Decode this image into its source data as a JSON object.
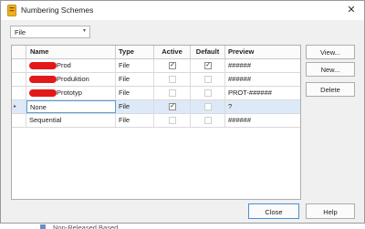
{
  "window": {
    "title": "Numbering Schemes",
    "close_glyph": "✕"
  },
  "filter": {
    "value": "File",
    "arrow_glyph": "▾"
  },
  "grid": {
    "columns": [
      "Name",
      "Type",
      "Active",
      "Default",
      "Preview"
    ],
    "rows": [
      {
        "name": "Prod",
        "type": "File",
        "active": true,
        "default": true,
        "preview": "######",
        "name_redacted": true,
        "selected": false
      },
      {
        "name": "Produktion",
        "type": "File",
        "active": false,
        "default": false,
        "preview": "######",
        "name_redacted": true,
        "selected": false
      },
      {
        "name": "Prototyp",
        "type": "File",
        "active": false,
        "default": false,
        "preview": "PROT-######",
        "name_redacted": true,
        "selected": false
      },
      {
        "name": "None",
        "type": "File",
        "active": true,
        "default": false,
        "preview": "?",
        "name_redacted": false,
        "selected": true
      },
      {
        "name": "Sequential",
        "type": "File",
        "active": false,
        "default": false,
        "preview": "######",
        "name_redacted": false,
        "selected": false
      }
    ],
    "current_row_glyph": "▸",
    "check_glyph": "✓"
  },
  "buttons": {
    "view": "View...",
    "new": "New...",
    "delete": "Delete",
    "close": "Close",
    "help": "Help"
  },
  "footer": {
    "text": "Non-Released Based"
  },
  "colors": {
    "accent": "#4a90d9",
    "selection": "#dde9f7",
    "redaction": "#e31919"
  }
}
